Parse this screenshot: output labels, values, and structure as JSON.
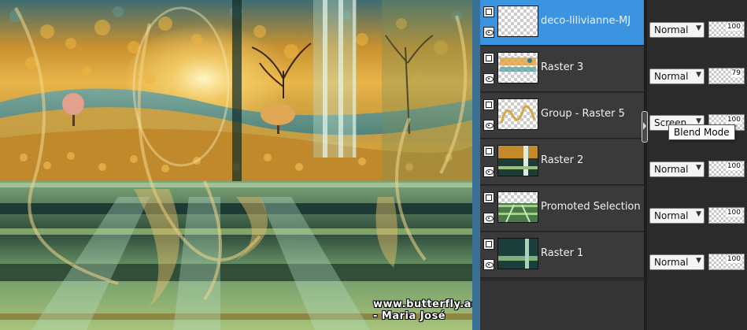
{
  "watermark": "www.butterfly.adv.br - Maria José",
  "layers": [
    {
      "name": "deco-lilivianne-MJ",
      "blend": "Normal",
      "opacity": "100",
      "selected": true
    },
    {
      "name": "Raster 3",
      "blend": "Normal",
      "opacity": "79",
      "selected": false
    },
    {
      "name": "Group - Raster 5",
      "blend": "Screen",
      "opacity": "100",
      "selected": false
    },
    {
      "name": "Raster 2",
      "blend": "Normal",
      "opacity": "100",
      "selected": false
    },
    {
      "name": "Promoted Selection",
      "blend": "Normal",
      "opacity": "100",
      "selected": false
    },
    {
      "name": "Raster 1",
      "blend": "Normal",
      "opacity": "100",
      "selected": false
    }
  ],
  "tooltip": "Blend Mode",
  "colors": {
    "selected_row": "#3c94e0",
    "panel_bg": "#2b2b2b",
    "row_bg": "#3a3a3a",
    "canvas_border": "#3a6f96"
  }
}
